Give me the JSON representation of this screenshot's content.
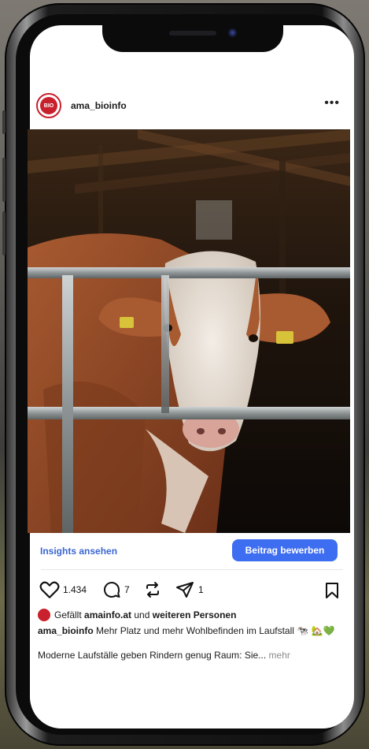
{
  "post": {
    "username": "ama_bioinfo",
    "avatar_text": "BIO"
  },
  "actions": {
    "insights_label": "Insights ansehen",
    "promote_label": "Beitrag bewerben",
    "likes_count": "1.434",
    "comments_count": "7",
    "shares_count": "1"
  },
  "caption": {
    "likes_prefix": "Gefällt ",
    "likes_user": "amainfo.at",
    "likes_mid": " und ",
    "likes_others": "weiteren Personen",
    "author": "ama_bioinfo",
    "text": " Mehr Platz und mehr Wohlbefinden im Laufstall 🐄 🏡💚",
    "text2": "Moderne Laufställe geben Rindern genug Raum: Sie...",
    "more": " mehr"
  },
  "icons": {
    "more": "more-horizontal-icon",
    "like": "heart-icon",
    "comment": "comment-icon",
    "repost": "repost-icon",
    "share": "send-icon",
    "bookmark": "bookmark-icon"
  },
  "colors": {
    "accent": "#3d6df0",
    "link": "#3a66d0",
    "brand_red": "#c8202c"
  }
}
